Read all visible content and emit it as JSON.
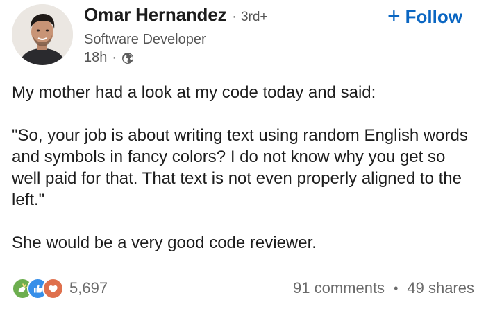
{
  "author": {
    "name": "Omar Hernandez",
    "separator": "·",
    "connection_degree": "3rd+",
    "headline": "Software Developer",
    "time_ago": "18h",
    "meta_separator": "·",
    "visibility_icon": "globe-icon"
  },
  "follow": {
    "icon": "+",
    "label": "Follow",
    "color": "#0a66c2"
  },
  "post": {
    "paragraphs": [
      "My mother had a look at my code today and said:",
      "\"So, your job is about writing text using random English words and symbols in fancy colors? I do not know why you get so well paid for that. That text is not even properly aligned to the left.\"",
      "She would be a very good code reviewer."
    ]
  },
  "social": {
    "reaction_icons": [
      "celebrate-icon",
      "like-icon",
      "love-icon"
    ],
    "reaction_count": "5,697",
    "comments": "91 comments",
    "separator": "•",
    "shares": "49 shares"
  },
  "colors": {
    "accent": "#0a66c2",
    "text_primary": "#1d1d1d",
    "text_secondary": "#555555",
    "celebrate": "#6dae4f",
    "like": "#378fe9",
    "love": "#df704d"
  }
}
